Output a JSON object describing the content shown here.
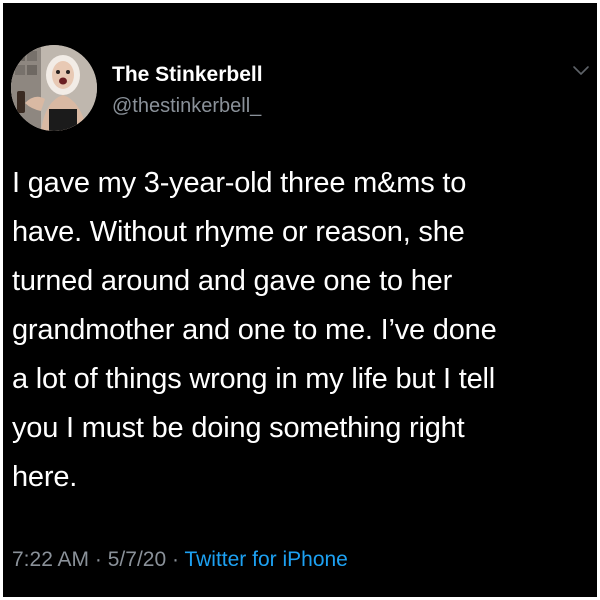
{
  "tweet": {
    "author": {
      "display_name": "The Stinkerbell",
      "handle": "@thestinkerbell_",
      "avatar_icon": "profile-photo"
    },
    "text_lines": [
      "I gave my 3-year-old three m&ms to",
      "have. Without rhyme or reason, she",
      "turned around and gave one to her",
      "grandmother and one to me. I’ve done",
      "a lot of things wrong in my life but I tell",
      "you I must be doing something right",
      "here."
    ],
    "time": "7:22 AM",
    "date": "5/7/20",
    "separator": "·",
    "source": "Twitter for iPhone",
    "menu_icon": "chevron-down-icon"
  },
  "colors": {
    "background": "#000000",
    "primary_text": "#ffffff",
    "secondary_text": "#8a9199",
    "link": "#1da1f2"
  }
}
